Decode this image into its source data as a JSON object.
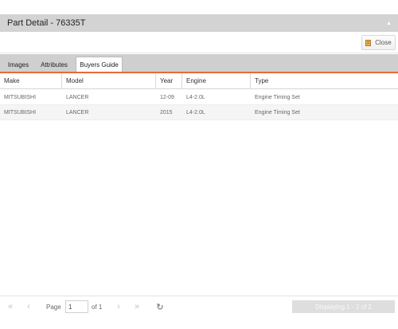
{
  "window": {
    "title": "Part Detail - 76335T"
  },
  "toolbar": {
    "close_label": "Close"
  },
  "tabs": [
    {
      "label": "Images"
    },
    {
      "label": "Attributes"
    },
    {
      "label": "Buyers Guide"
    }
  ],
  "active_tab": "Buyers Guide",
  "grid": {
    "columns": [
      "Make",
      "Model",
      "Year",
      "Engine",
      "Type"
    ],
    "rows": [
      {
        "make": "MITSUBISHI",
        "model": "LANCER",
        "year": "12-09",
        "engine": "L4-2.0L",
        "type": "Engine Timing Set"
      },
      {
        "make": "MITSUBISHI",
        "model": "LANCER",
        "year": "2015",
        "engine": "L4-2.0L",
        "type": "Engine Timing Set"
      }
    ]
  },
  "pager": {
    "page_label": "Page",
    "page_value": "1",
    "of_label": "of 1",
    "displaying": "Displaying 1 - 2 of 2"
  },
  "colors": {
    "accent": "#e66a3a",
    "title_bar": "#d3d3d3",
    "tab_bar": "#cfcfcf",
    "row_alt": "#f5f5f5"
  },
  "icons": [
    "collapse-icon",
    "close-icon",
    "first-page-icon",
    "prev-page-icon",
    "next-page-icon",
    "last-page-icon",
    "refresh-icon"
  ]
}
